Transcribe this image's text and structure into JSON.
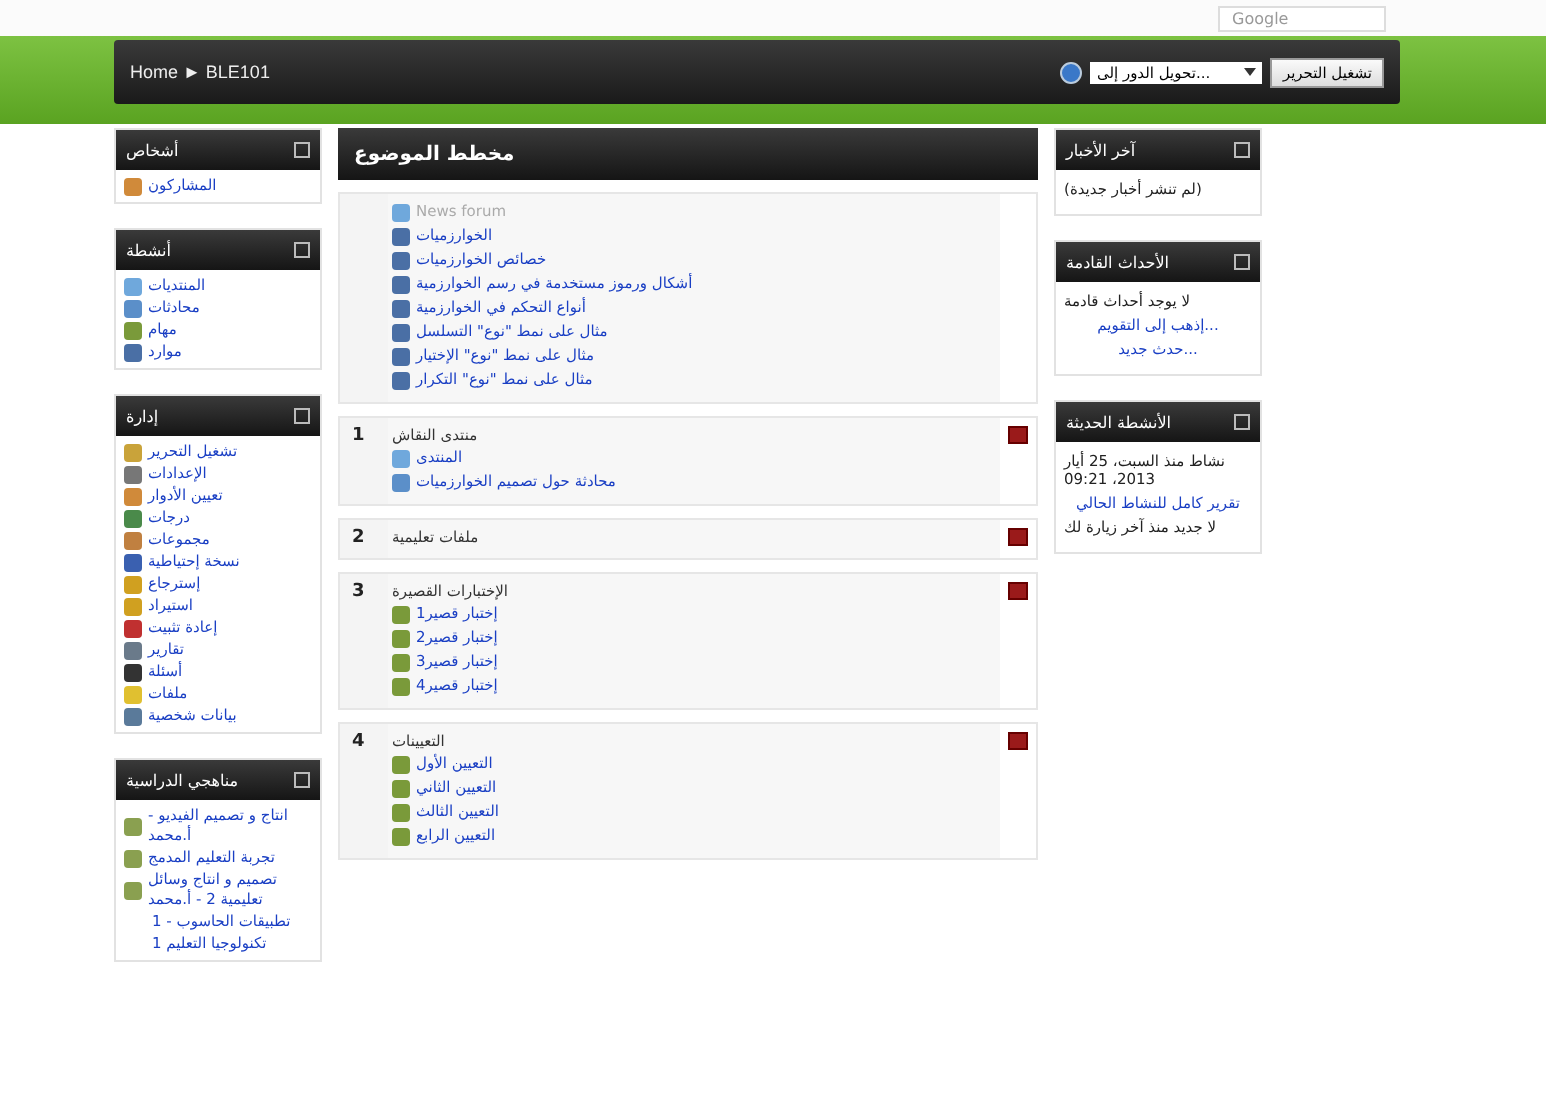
{
  "browser": {
    "search_placeholder": "Google"
  },
  "navbar": {
    "breadcrumb": "Home ► BLE101",
    "role_select": "تحويل الدور إلى...",
    "edit_button": "تشغيل التحرير"
  },
  "left_blocks": [
    {
      "title": "أشخاص",
      "items": [
        {
          "label": "المشاركون",
          "kind": "people"
        }
      ]
    },
    {
      "title": "أنشطة",
      "items": [
        {
          "label": "المنتديات",
          "kind": "forum"
        },
        {
          "label": "محادثات",
          "kind": "chat"
        },
        {
          "label": "مهام",
          "kind": "assignment"
        },
        {
          "label": "موارد",
          "kind": "page"
        }
      ]
    },
    {
      "title": "إدارة",
      "items": [
        {
          "label": "تشغيل التحرير",
          "kind": "edit"
        },
        {
          "label": "الإعدادات",
          "kind": "settings"
        },
        {
          "label": "تعيين الأدوار",
          "kind": "people"
        },
        {
          "label": "درجات",
          "kind": "grades"
        },
        {
          "label": "مجموعات",
          "kind": "groups"
        },
        {
          "label": "نسخة إحتياطية",
          "kind": "backup"
        },
        {
          "label": "إسترجاع",
          "kind": "restore"
        },
        {
          "label": "استيراد",
          "kind": "restore"
        },
        {
          "label": "إعادة تثبيت",
          "kind": "reset"
        },
        {
          "label": "تقارير",
          "kind": "reports"
        },
        {
          "label": "أسئلة",
          "kind": "questions"
        },
        {
          "label": "ملفات",
          "kind": "files"
        },
        {
          "label": "بيانات شخصية",
          "kind": "profile"
        }
      ]
    },
    {
      "title": "مناهجي الدراسية",
      "items": [
        {
          "label": "انتاج و تصميم الفيديو - أ.محمد",
          "kind": "course"
        },
        {
          "label": "تجربة التعليم المدمج",
          "kind": "course"
        },
        {
          "label": "تصميم و انتاج وسائل تعليمية 2 - أ.محمد",
          "kind": "course"
        },
        {
          "label": "تطبيقات الحاسوب - 1",
          "kind": "none"
        },
        {
          "label": "تكنولوجيا التعليم 1",
          "kind": "none"
        }
      ]
    }
  ],
  "main": {
    "title": "مخطط الموضوع",
    "sections": [
      {
        "items": [
          {
            "label": "News forum",
            "kind": "forum",
            "dimmed": true
          },
          {
            "label": "الخوارزميات",
            "kind": "page",
            "dimmed": false
          },
          {
            "label": "خصائص الخوارزميات",
            "kind": "page",
            "dimmed": false
          },
          {
            "label": "أشكال ورموز مستخدمة في رسم الخوارزمية",
            "kind": "page",
            "dimmed": false
          },
          {
            "label": "أنواع التحكم في الخوارزمية",
            "kind": "page",
            "dimmed": false
          },
          {
            "label": "مثال على نمط \"نوع\" التسلسل",
            "kind": "page",
            "dimmed": false
          },
          {
            "label": "مثال على نمط \"نوع\" الإختيار",
            "kind": "page",
            "dimmed": false
          },
          {
            "label": "مثال على نمط \"نوع\" التكرار",
            "kind": "page",
            "dimmed": false
          }
        ]
      },
      {
        "number": "1",
        "title": "منتدى النقاش",
        "items": [
          {
            "label": "المنتدى",
            "kind": "forum",
            "dimmed": false
          },
          {
            "label": "محادثة حول تصميم الخوارزميات",
            "kind": "chat",
            "dimmed": false
          }
        ]
      },
      {
        "number": "2",
        "title": "ملفات تعليمية"
      },
      {
        "number": "3",
        "title": "الإختبارات القصيرة",
        "items": [
          {
            "label": "إختبار قصير1",
            "kind": "assignment",
            "dimmed": false
          },
          {
            "label": "إختبار قصير2",
            "kind": "assignment",
            "dimmed": false
          },
          {
            "label": "إختبار قصير3",
            "kind": "assignment",
            "dimmed": false
          },
          {
            "label": "إختبار قصير4",
            "kind": "assignment",
            "dimmed": false
          }
        ]
      },
      {
        "number": "4",
        "title": "التعيينات",
        "items": [
          {
            "label": "التعيين الأول",
            "kind": "assignment",
            "dimmed": false
          },
          {
            "label": "التعيين الثاني",
            "kind": "assignment",
            "dimmed": false
          },
          {
            "label": "التعيين الثالث",
            "kind": "assignment",
            "dimmed": false
          },
          {
            "label": "التعيين الرابع",
            "kind": "assignment",
            "dimmed": false
          }
        ]
      }
    ]
  },
  "right_blocks": [
    {
      "title": "آخر الأخبار",
      "lines": [
        {
          "text": "(لم تنشر أخبار جديدة)",
          "kind": "text"
        }
      ]
    },
    {
      "title": "الأحداث القادمة",
      "lines": [
        {
          "text": "لا يوجد أحداث قادمة",
          "kind": "text"
        },
        {
          "text": "إذهب إلى التقويم...",
          "kind": "link"
        },
        {
          "text": "حدث جديد...",
          "kind": "link"
        }
      ]
    },
    {
      "title": "الأنشطة الحديثة",
      "lines": [
        {
          "text": "نشاط منذ السبت، 25 أيار 2013، 09:21",
          "kind": "text"
        },
        {
          "text": "تقرير كامل للنشاط الحالي",
          "kind": "link"
        },
        {
          "text": "لا جديد منذ آخر زيارة لك",
          "kind": "text"
        }
      ]
    }
  ]
}
